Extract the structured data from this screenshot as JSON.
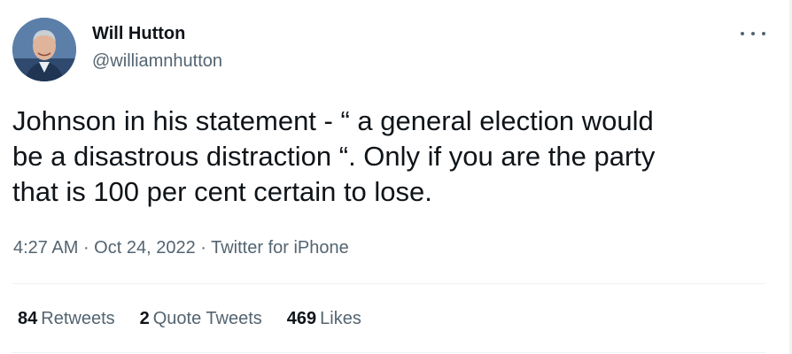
{
  "author": {
    "name": "Will Hutton",
    "handle": "@williamnhutton",
    "avatar": "profile-photo"
  },
  "tweet": {
    "text": "Johnson in his statement - “ a general election would\nbe a disastrous distraction “. Only if you are the party\nthat is 100 per cent certain to lose.",
    "time": "4:27 AM",
    "date": "Oct 24, 2022",
    "source": "Twitter for iPhone",
    "separator": "·"
  },
  "stats": {
    "retweets": {
      "count": "84",
      "label": "Retweets"
    },
    "quotes": {
      "count": "2",
      "label": "Quote Tweets"
    },
    "likes": {
      "count": "469",
      "label": "Likes"
    }
  },
  "colors": {
    "primary_text": "#0f1419",
    "secondary_text": "#536471",
    "divider": "#eff3f4"
  }
}
